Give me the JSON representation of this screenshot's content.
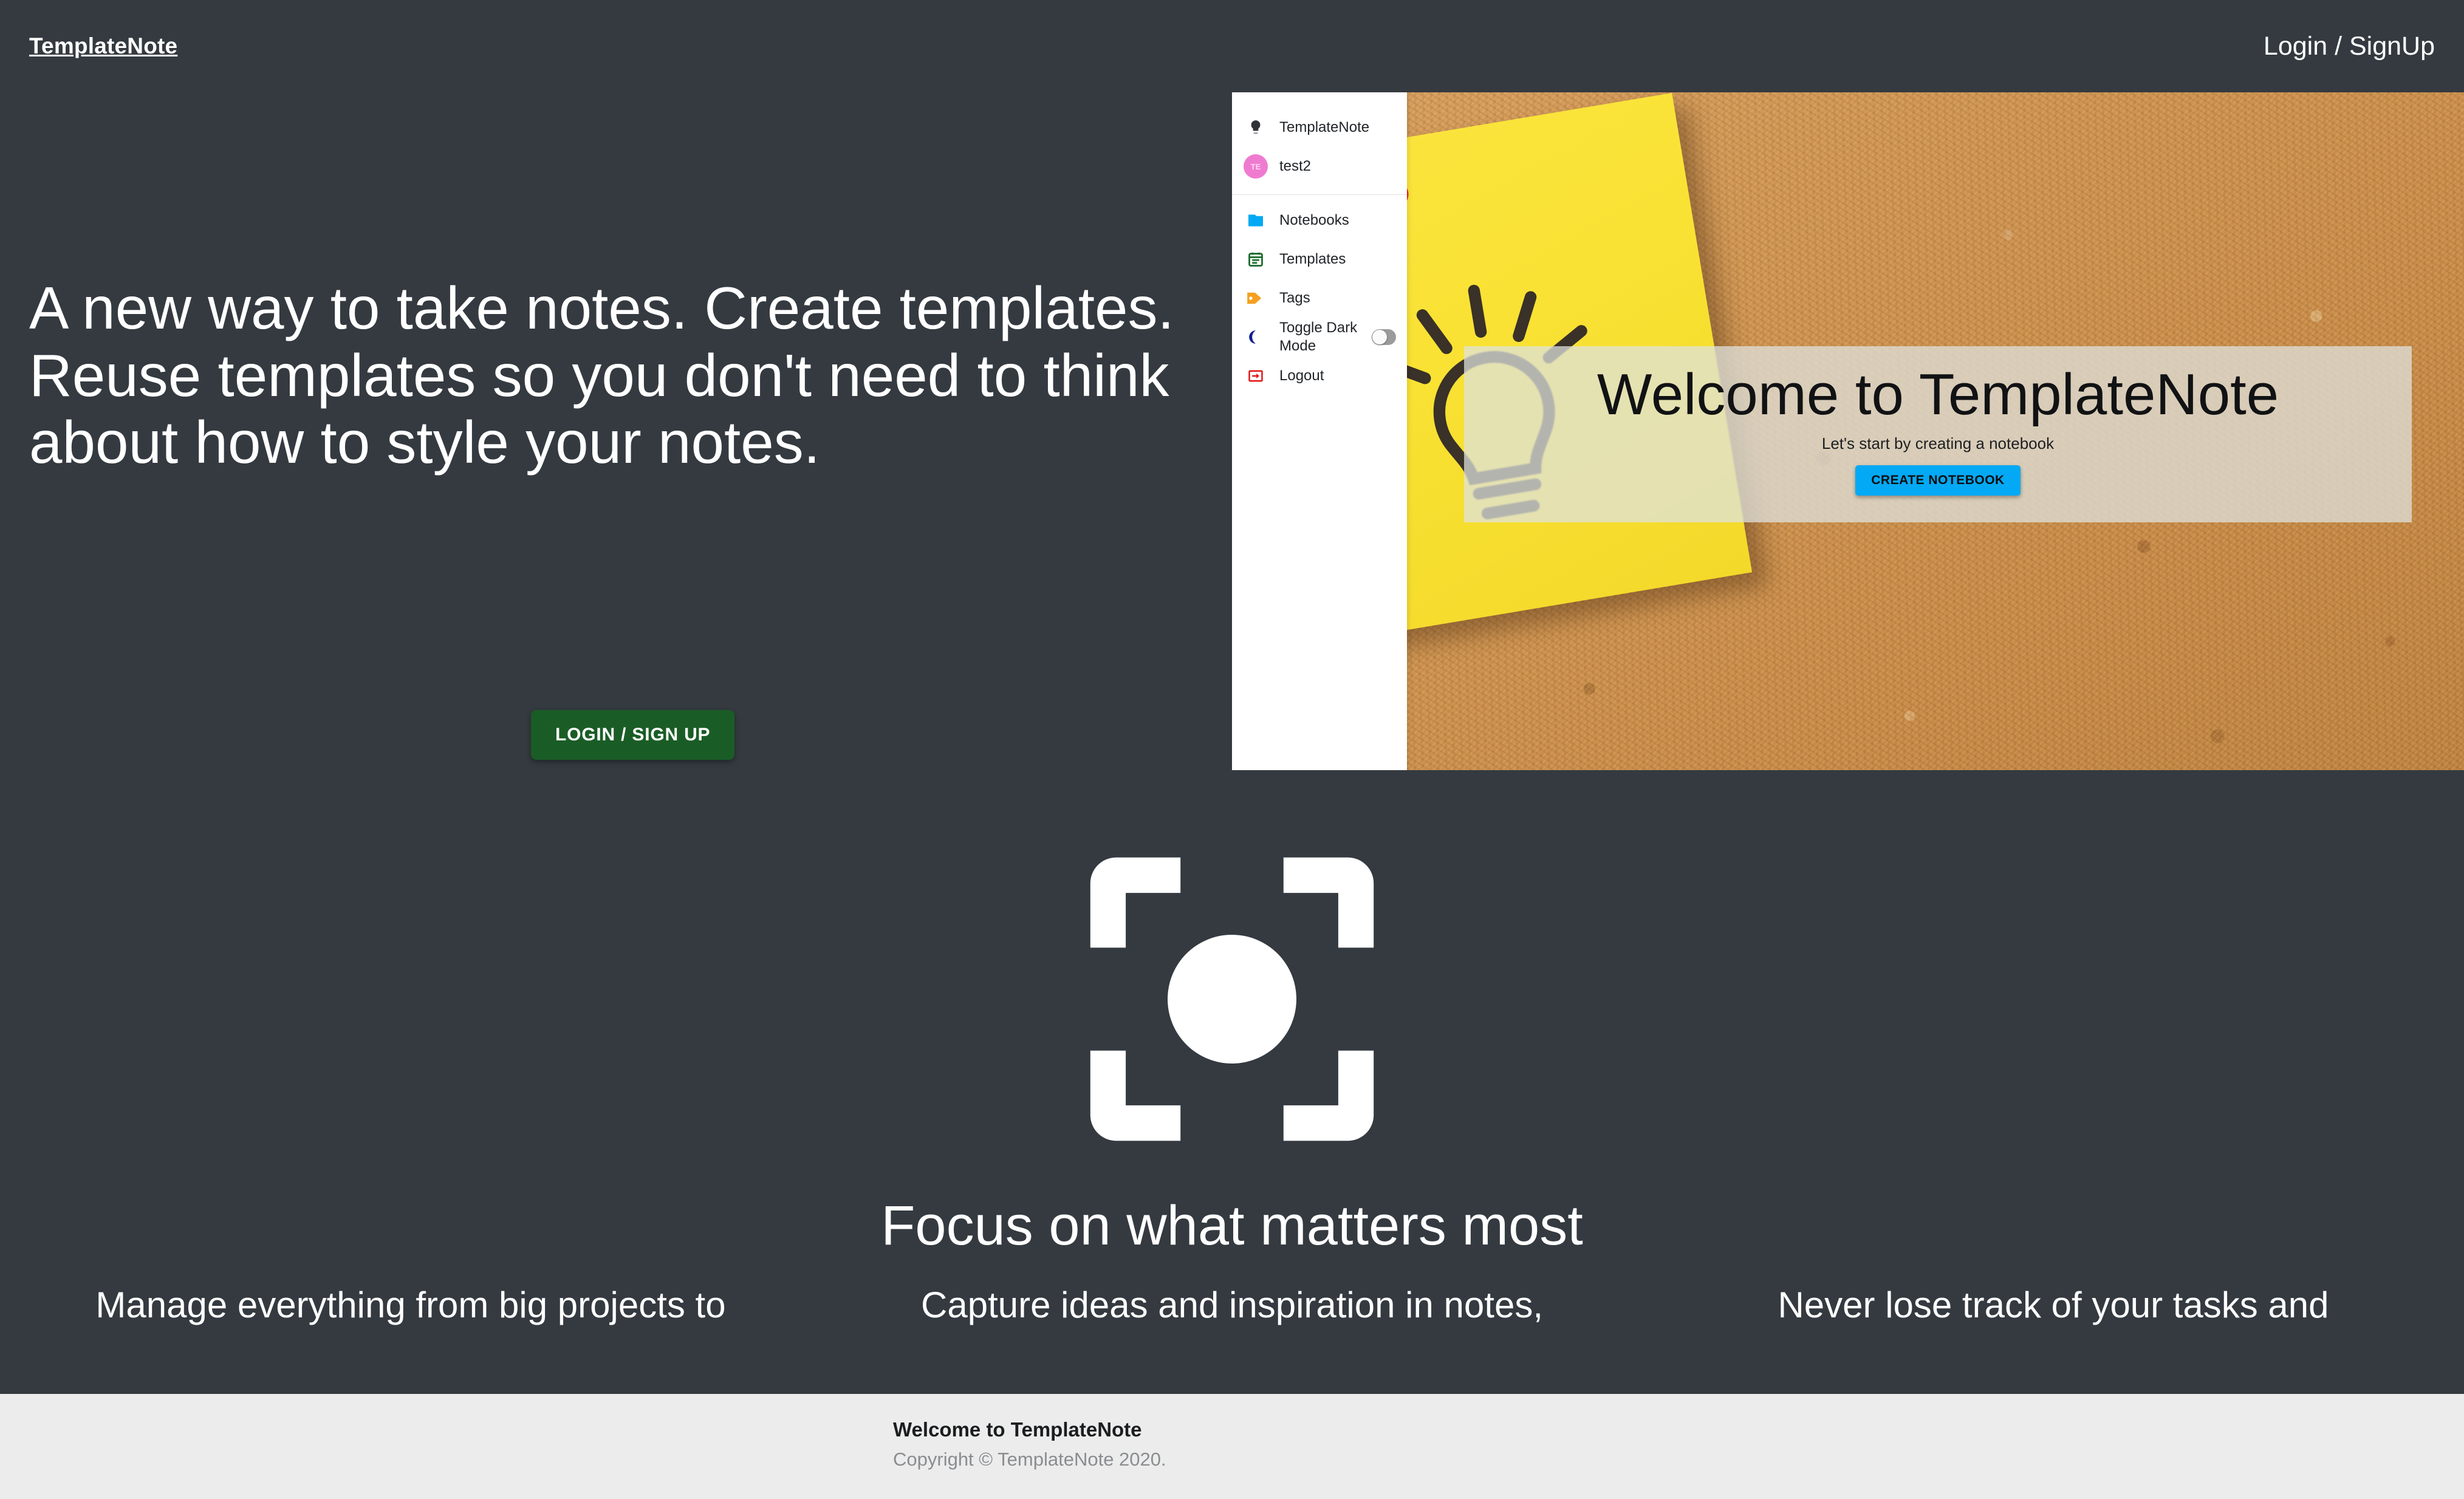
{
  "navbar": {
    "brand": "TemplateNote",
    "login_link": "Login / SignUp"
  },
  "hero": {
    "headline": "A new way to take notes. Create templates. Reuse templates so you don't need to think about how to style your notes.",
    "cta_label": "LOGIN / SIGN UP",
    "cta_color": "#1a5c26"
  },
  "app_preview": {
    "sidebar": {
      "items": [
        {
          "label": "TemplateNote",
          "icon": "lightbulb-icon",
          "icon_color": "#2f3337"
        },
        {
          "label": "test2",
          "icon": "user-avatar",
          "avatar_initials": "TE",
          "icon_color": "#ef7bd0"
        },
        {
          "label": "Notebooks",
          "icon": "notebook-folder-icon",
          "icon_color": "#03a9f4"
        },
        {
          "label": "Templates",
          "icon": "calendar-template-icon",
          "icon_color": "#1b6b2c"
        },
        {
          "label": "Tags",
          "icon": "tag-icon",
          "icon_color": "#f5a020"
        },
        {
          "label": "Toggle Dark Mode",
          "icon": "moon-icon",
          "icon_color": "#111f8f",
          "toggle_state": "off"
        },
        {
          "label": "Logout",
          "icon": "logout-icon",
          "icon_color": "#e01b1b"
        }
      ]
    },
    "welcome_panel": {
      "title": "Welcome to TemplateNote",
      "subtitle": "Let's start by creating a notebook",
      "button_label": "CREATE NOTEBOOK",
      "button_color": "#03a9f4"
    },
    "board": {
      "background": "cork-board",
      "sticky_note_color": "#f9e233",
      "pushpin_color": "#e8291b",
      "note_drawing": "lightbulb-sketch"
    }
  },
  "features": {
    "icon": "center-focus-icon",
    "heading": "Focus on what matters most",
    "columns": [
      {
        "text": "Manage everything from big projects to"
      },
      {
        "text": "Capture ideas and inspiration in notes,"
      },
      {
        "text": "Never lose track of your tasks and"
      }
    ]
  },
  "footer": {
    "title": "Welcome to TemplateNote",
    "copyright": "Copyright © TemplateNote 2020."
  },
  "theme": {
    "page_background": "#343a40",
    "footer_background": "#ececec",
    "text_color": "#ffffff"
  }
}
